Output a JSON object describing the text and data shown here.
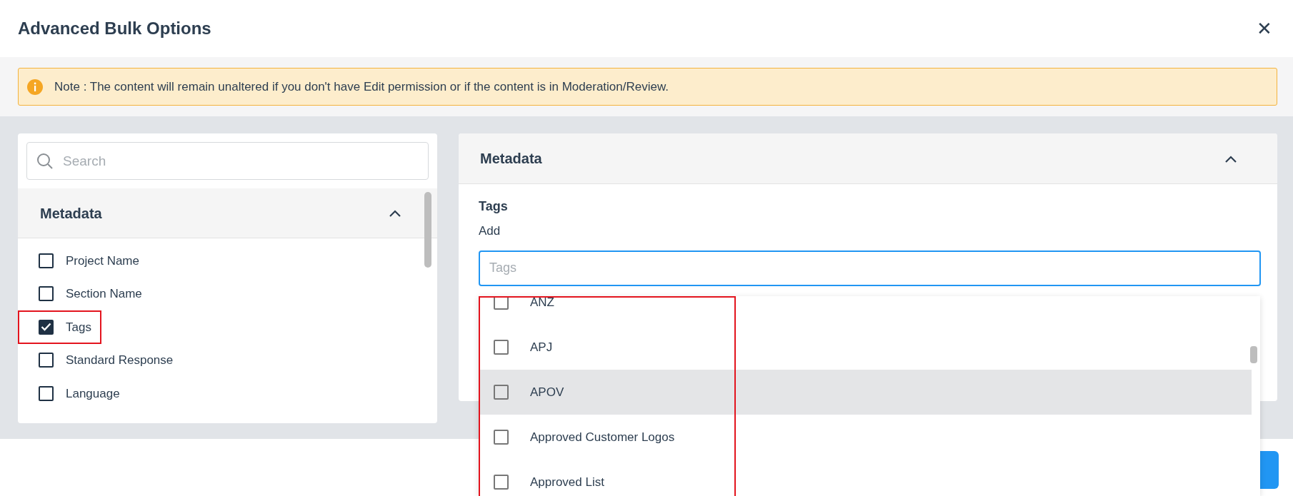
{
  "dialog": {
    "title": "Advanced Bulk Options",
    "close": "✕"
  },
  "note": "Note : The content will remain unaltered if you don't have Edit permission or if the content is in Moderation/Review.",
  "field_list": {
    "search": {
      "placeholder": "Search"
    },
    "section": {
      "title": "Metadata",
      "expanded": true
    },
    "items": [
      {
        "label": "Project Name",
        "checked": false,
        "highlighted": false
      },
      {
        "label": "Section Name",
        "checked": false,
        "highlighted": false
      },
      {
        "label": "Tags",
        "checked": true,
        "highlighted": true
      },
      {
        "label": "Standard Response",
        "checked": false,
        "highlighted": false
      },
      {
        "label": "Language",
        "checked": false,
        "highlighted": false
      }
    ]
  },
  "editor": {
    "section": {
      "title": "Metadata",
      "expanded": true
    },
    "field_label": "Tags",
    "action": "Add",
    "tags_input": {
      "placeholder": "Tags"
    },
    "dropdown": {
      "highlighted": true,
      "options": [
        {
          "label": "ANZ",
          "checked": false,
          "hovered": false
        },
        {
          "label": "APJ",
          "checked": false,
          "hovered": false
        },
        {
          "label": "APOV",
          "checked": false,
          "hovered": true
        },
        {
          "label": "Approved Customer Logos",
          "checked": false,
          "hovered": false
        },
        {
          "label": "Approved List",
          "checked": false,
          "hovered": false
        }
      ]
    }
  }
}
